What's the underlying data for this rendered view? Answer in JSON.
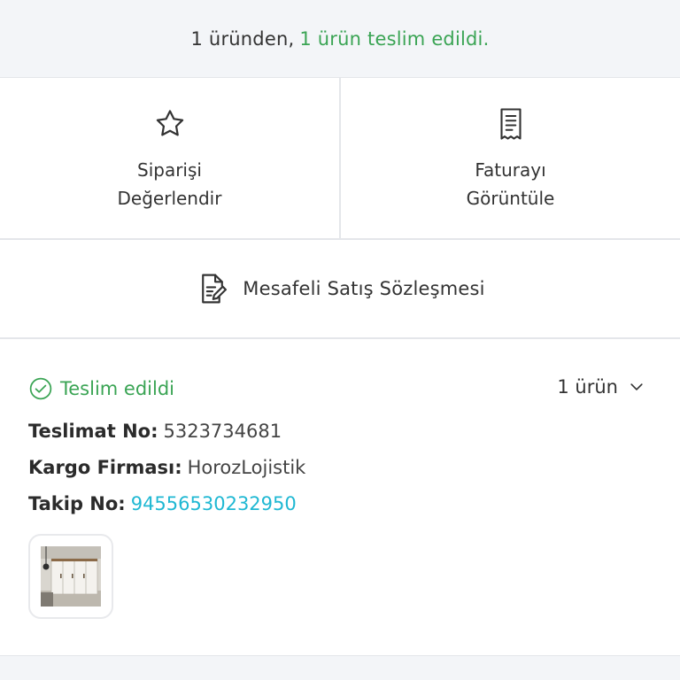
{
  "banner": {
    "count_text": "1 üründen,",
    "delivered_text": "1 ürün teslim edildi."
  },
  "actions": [
    {
      "icon": "star-icon",
      "line1": "Siparişi",
      "line2": "Değerlendir"
    },
    {
      "icon": "receipt-icon",
      "line1": "Faturayı",
      "line2": "Görüntüle"
    }
  ],
  "contract": {
    "icon": "document-edit-icon",
    "label": "Mesafeli Satış Sözleşmesi"
  },
  "shipment": {
    "status": "Teslim edildi",
    "item_count": "1 ürün",
    "delivery_no_label": "Teslimat No:",
    "delivery_no": "5323734681",
    "carrier_label": "Kargo Firması:",
    "carrier": "HorozLojistik",
    "tracking_label": "Takip No:",
    "tracking_no": "94556530232950"
  },
  "colors": {
    "success": "#3aa454",
    "link": "#1fb8d3",
    "banner_bg": "#f3f5f8",
    "divider": "#e4e6ea"
  }
}
